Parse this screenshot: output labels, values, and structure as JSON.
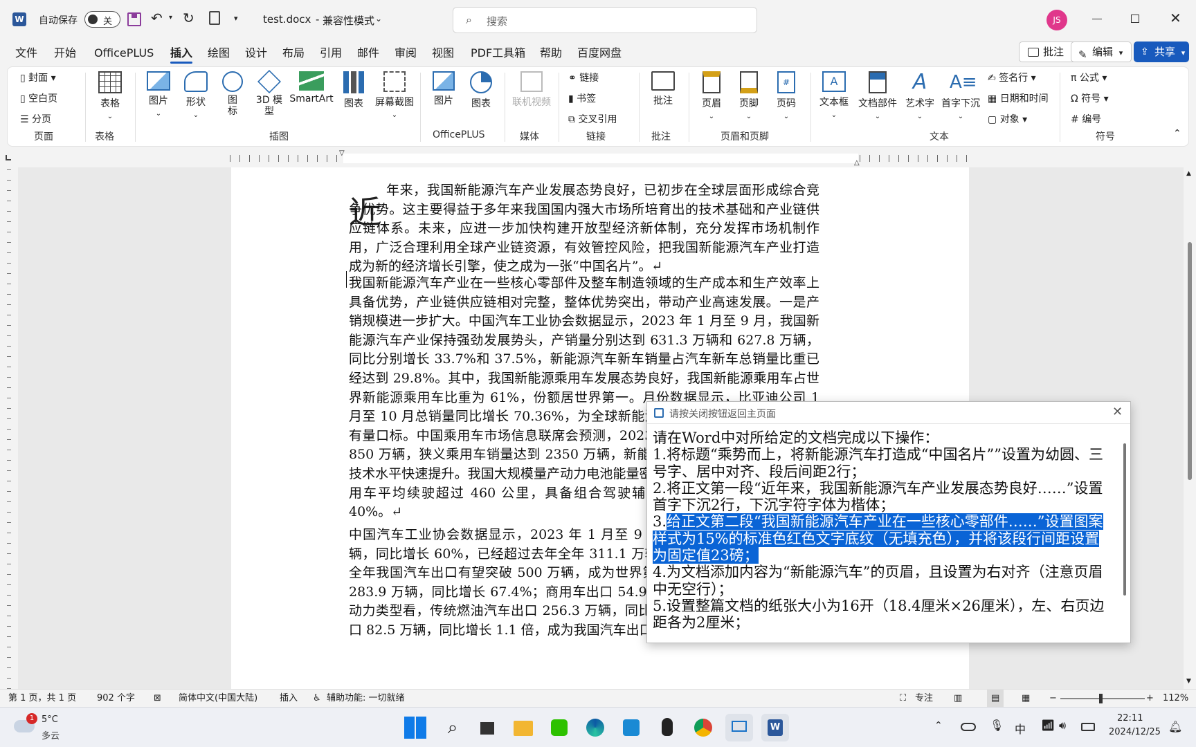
{
  "titlebar": {
    "autosave_label": "自动保存",
    "autosave_state": "关",
    "doc_title": "test.docx",
    "doc_mode": "兼容性模式",
    "search_placeholder": "搜索",
    "avatar": "JS"
  },
  "menu_tabs": [
    "文件",
    "开始",
    "OfficePLUS",
    "插入",
    "绘图",
    "设计",
    "布局",
    "引用",
    "邮件",
    "审阅",
    "视图",
    "PDF工具箱",
    "帮助",
    "百度网盘"
  ],
  "active_tab": "插入",
  "right_buttons": {
    "comment": "批注",
    "edit": "编辑",
    "share": "共享"
  },
  "ribbon": {
    "page": {
      "cover": "封面",
      "blank": "空白页",
      "break": "分页",
      "group": "页面"
    },
    "table": {
      "table": "表格",
      "group": "表格"
    },
    "illustrations": {
      "picture": "图片",
      "shapes": "形状",
      "icons": "图\n标",
      "model3d": "3D 模\n型",
      "smartart": "SmartArt",
      "chart": "图表",
      "screenshot": "屏幕截图",
      "group": "插图"
    },
    "officeplus": {
      "picture": "图片",
      "chart": "图表",
      "group": "OfficePLUS"
    },
    "media": {
      "video": "联机视频",
      "group": "媒体"
    },
    "links": {
      "link": "链接",
      "bookmark": "书签",
      "crossref": "交叉引用",
      "group": "链接"
    },
    "comments": {
      "comment": "批注",
      "group": "批注"
    },
    "headerfooter": {
      "header": "页眉",
      "footer": "页脚",
      "pagenum": "页码",
      "group": "页眉和页脚"
    },
    "text": {
      "textbox": "文本框",
      "parts": "文档部件",
      "wordart": "艺术字",
      "dropcap": "首字下沉",
      "signature": "签名行",
      "datetime": "日期和时间",
      "object": "对象",
      "group": "文本"
    },
    "symbols": {
      "equation": "公式",
      "symbol": "符号",
      "number": "编号",
      "group": "符号"
    }
  },
  "document": {
    "dropcap": "近",
    "p1": "年来，我国新能源汽车产业发展态势良好，已初步在全球层面形成综合竞争优势。这主要得益于多年来我国国内强大市场所培育出的技术基础和产业链供应链体系。未来，应进一步加快构建开放型经济新体制，充分发挥市场机制作用，广泛合理利用全球产业链资源，有效管控风险，把我国新能源汽车产业打造成为新的经济增长引擎，使之成为一张“中国名片”。↵",
    "p2": "我国新能源汽车产业在一些核心零部件及整车制造领域的生产成本和生产效率上具备优势，产业链供应链相对完整，整体优势突出，带动产业高速发展。一是产销规模进一步扩大。中国汽车工业协会数据显示，2023 年 1 月至 9 月，我国新能源汽车产业保持强劲发展势头，产销量分别达到 631.3 万辆和 627.8 万辆，同比分别增长 33.7%和 37.5%，新能源汽车新车销量占汽车新车总销量比重已经达到 29.8%。其中，我国新能源乘用车发展态势良好，我国新能源乘用车占世界新能源乘用车比重为 61%，份额居世界第一。月份数据显示，比亚迪公司 1 月至 10 月总销量同比增长 70.36%，为全球新能源汽车企业销量冠军，行业内有量口标。中国乘用车市场信息联席会预测，2023 年新能源乘用车销量将达到 850 万辆，狭义乘用车销量达到 2350 万辆，新能源渗透率将达到 36%。二是技术水平快速提升。我国大规模量产动力电池能量密度达到 瓦时/公斤，纯电动乘用车平均续驶超过 460 公里，具备组合驾驶辅助驾驶功能的车辆占比超过 40%。↵",
    "p3": "中国汽车工业协会数据显示，2023 年 1 月至 9 月，我国汽车出口 338.8 万辆，同比增长 60%，已经超过去年全年 311.1 万辆的出口总量，有望首次全年全年我国汽车出口有望突破 500 万辆，成为世界第一汽车出口国。乘用车出口 283.9 万辆，同比增长 67.4%；商用车出口 54.9 万辆，同比增长 30.2%。从动力类型看，传统燃油汽车出口 256.3 万辆，同比增长 48.3%；新能源汽车出口 82.5 万辆，同比增长 1.1 倍，成为我国汽车出口中坚力量。在出口量增的同"
  },
  "dialog": {
    "title": "请按关闭按钮返回主页面",
    "intro": "请在Word中对所给定的文档完成以下操作：",
    "item1": "1.将标题“乘势而上，将新能源汽车打造成“中国名片””设置为幼圆、三号字、居中对齐、段后间距2行；",
    "item2": "2.将正文第一段“近年来，我国新能源汽车产业发展态势良好……”设置首字下沉2行，下沉字符字体为楷体；",
    "item3_num": "3.",
    "item3": "给正文第二段“我国新能源汽车产业在一些核心零部件……”设置图案样式为15%的标准色红色文字底纹（无填充色），并将该段行间距设置为固定值23磅；",
    "item4": "4.为文档添加内容为“新能源汽车”的页眉，且设置为右对齐（注意页眉中无空行）；",
    "item5": "5.设置整篇文档的纸张大小为16开（18.4厘米×26厘米），左、右页边距各为2厘米；"
  },
  "status": {
    "page": "第 1 页，共 1 页",
    "words": "902 个字",
    "lang": "简体中文(中国大陆)",
    "mode": "插入",
    "accessibility": "辅助功能: 一切就绪",
    "focus": "专注",
    "zoom": "112%"
  },
  "taskbar": {
    "weather_badge": "1",
    "temp": "5°C",
    "weather": "多云",
    "time": "22:11",
    "date": "2024/12/25",
    "ime": "中"
  },
  "colors": {
    "accent": "#185abd",
    "highlight": "#0a64d6",
    "word_blue": "#2b579a",
    "save_purple": "#8b3c9b",
    "avatar": "#e0378b"
  }
}
